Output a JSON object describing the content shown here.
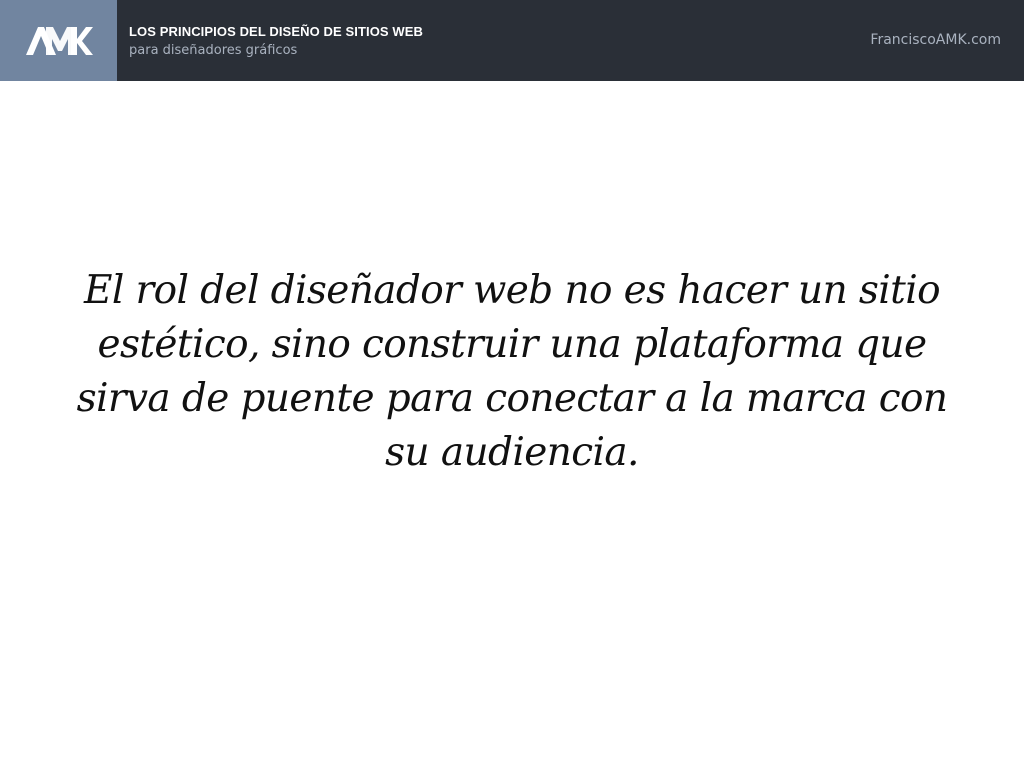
{
  "header": {
    "logo_text": "AMK",
    "title": "LOS PRINCIPIOS DEL DISEÑO DE SITIOS WEB",
    "subtitle": "para diseñadores gráficos",
    "site": "FranciscoAMK.com"
  },
  "main": {
    "quote": "El rol del diseñador web no es hacer un sitio estético, sino construir una plataforma que sirva de puente para conectar a la marca con su audiencia."
  },
  "colors": {
    "header_bg": "#2a2f37",
    "logo_bg": "#7185a0",
    "subtitle_text": "#a9b2bf"
  }
}
